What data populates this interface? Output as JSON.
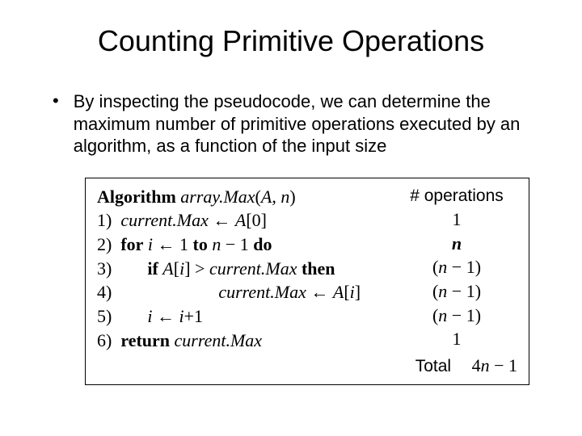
{
  "title": "Counting Primitive Operations",
  "bullet": "By inspecting the pseudocode, we can determine the maximum number of primitive operations executed by an algorithm, as a function of the input size",
  "algo": {
    "header_kw": "Algorithm",
    "header_name": "array.Max",
    "header_args_open": "(",
    "header_arg1": "A",
    "header_comma": ", ",
    "header_arg2": "n",
    "header_args_close": ")",
    "ops_header": "# operations",
    "lines": [
      {
        "num": "1)",
        "pre": "  ",
        "cm_var": "current.Max",
        "mid": " ",
        "arrow": "←",
        "post": " ",
        "a_var": "A",
        "idx": "[0]",
        "ops": "1"
      },
      {
        "num": "2)",
        "pre": "  ",
        "kw1": "for",
        "sp1": " ",
        "ivar": "i",
        "sp2": " ",
        "arrow": "←",
        "sp3": " 1 ",
        "kw2": "to",
        "sp4": " ",
        "nvar": "n",
        "minus": " − 1 ",
        "kw3": "do",
        "ops_n": "n"
      },
      {
        "num": "3)",
        "pre": "        ",
        "kw1": "if",
        "sp1": " ",
        "a_var": "A",
        "idx_open": "[",
        "ivar": "i",
        "idx_close": "]",
        "gt": " > ",
        "cm_var": "current.Max",
        "sp2": " ",
        "kw2": "then",
        "ops_open": "(",
        "ops_n": "n",
        "ops_close": " − 1)"
      },
      {
        "num": "4)",
        "pre": "                        ",
        "cm_var": "current.Max",
        "sp1": " ",
        "arrow": "←",
        "sp2": " ",
        "a_var": "A",
        "idx_open": "[",
        "ivar": "i",
        "idx_close": "]",
        "ops_open": "(",
        "ops_n": "n",
        "ops_close": " − 1)"
      },
      {
        "num": "5)",
        "pre": "        ",
        "ivar": "i",
        "sp1": " ",
        "arrow": "←",
        "sp2": " ",
        "ivar2": "i",
        "plus": "+1",
        "ops_open": "(",
        "ops_n": "n",
        "ops_close": " − 1)"
      },
      {
        "num": "6)",
        "pre": "  ",
        "kw1": "return",
        "sp1": " ",
        "cm_var": "current.Max",
        "ops": "1"
      }
    ],
    "total_label": "Total",
    "total_val_pre": "4",
    "total_val_n": "n",
    "total_val_post": " − 1"
  }
}
